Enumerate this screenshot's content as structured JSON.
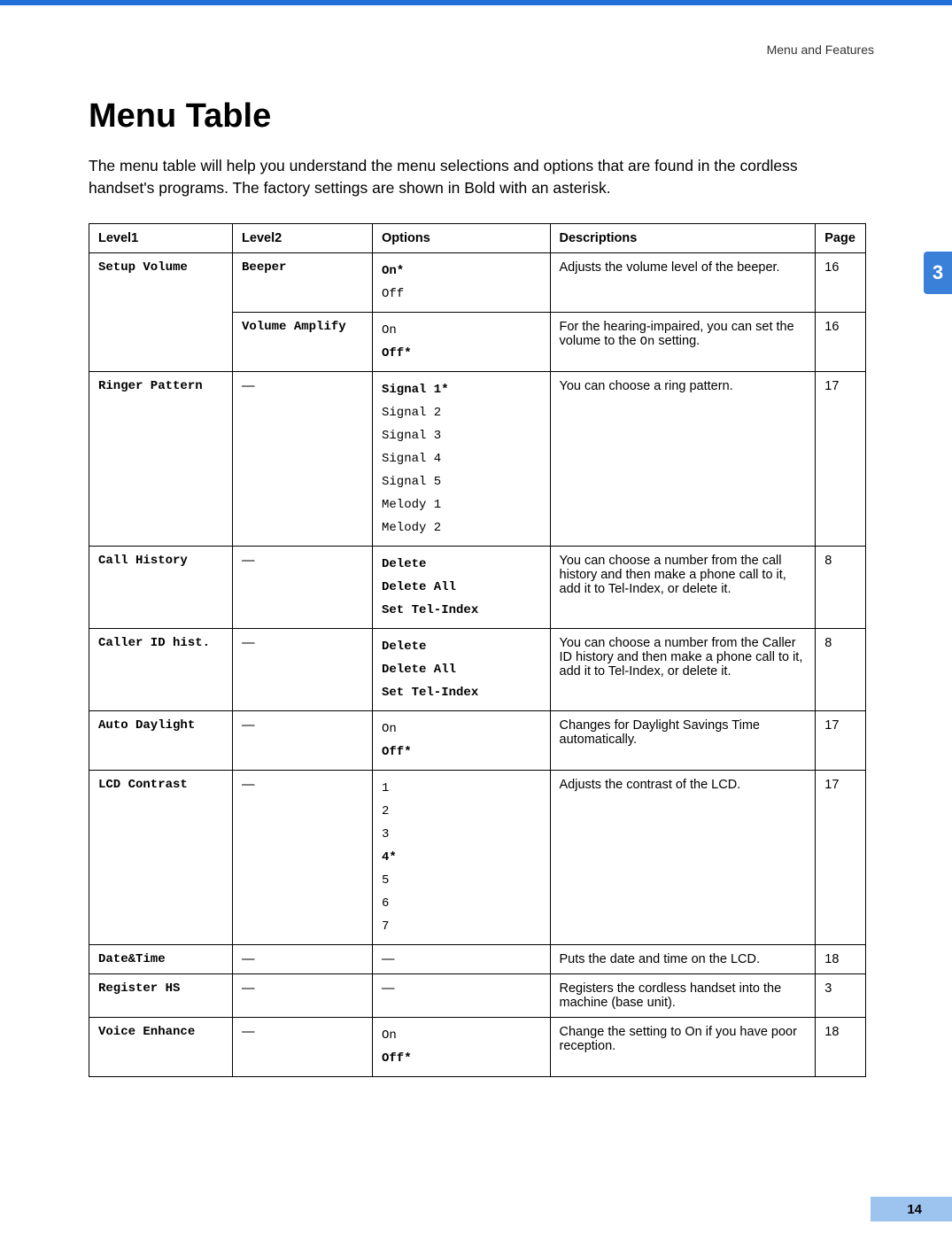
{
  "header": {
    "section_label": "Menu and Features"
  },
  "title": "Menu Table",
  "intro": "The menu table will help you understand the menu selections and options that are found in the cordless handset's programs. The factory settings are shown in Bold with an asterisk.",
  "side_tab": "3",
  "page_number": "14",
  "columns": {
    "level1": "Level1",
    "level2": "Level2",
    "options": "Options",
    "descriptions": "Descriptions",
    "page": "Page"
  },
  "rows": [
    {
      "level1": "Setup Volume",
      "level1_rowspan": 2,
      "level2": "Beeper",
      "options": [
        {
          "text": "On*",
          "bold": true
        },
        {
          "text": "Off",
          "bold": false
        }
      ],
      "desc_pre": "Adjusts the volume level of the beeper.",
      "page": "16"
    },
    {
      "level2": "Volume Amplify",
      "options": [
        {
          "text": "On",
          "bold": false
        },
        {
          "text": "Off*",
          "bold": true
        }
      ],
      "desc_pre": "For the hearing-impaired, you can set the volume to the ",
      "desc_mono": "On",
      "desc_post": " setting.",
      "page": "16"
    },
    {
      "level1": "Ringer Pattern",
      "level2": "—",
      "options": [
        {
          "text": "Signal 1*",
          "bold": true
        },
        {
          "text": "Signal 2",
          "bold": false
        },
        {
          "text": "Signal 3",
          "bold": false
        },
        {
          "text": "Signal 4",
          "bold": false
        },
        {
          "text": "Signal 5",
          "bold": false
        },
        {
          "text": "Melody 1",
          "bold": false
        },
        {
          "text": "Melody 2",
          "bold": false
        }
      ],
      "desc_pre": "You can choose a ring pattern.",
      "page": "17"
    },
    {
      "level1": "Call History",
      "level2": "—",
      "options": [
        {
          "text": "Delete",
          "bold": true
        },
        {
          "text": "Delete All",
          "bold": true
        },
        {
          "text": "Set Tel-Index",
          "bold": true
        }
      ],
      "desc_pre": "You can choose a number from the call history and then make a phone call to it, add it to Tel-Index, or delete it.",
      "page": "8"
    },
    {
      "level1": "Caller ID hist.",
      "level2": "—",
      "options": [
        {
          "text": "Delete",
          "bold": true
        },
        {
          "text": "Delete All",
          "bold": true
        },
        {
          "text": "Set Tel-Index",
          "bold": true
        }
      ],
      "desc_pre": "You can choose a number from the Caller ID history and then make a phone call to it, add it to Tel-Index, or delete it.",
      "page": "8"
    },
    {
      "level1": "Auto Daylight",
      "level2": "—",
      "options": [
        {
          "text": "On",
          "bold": false
        },
        {
          "text": "Off*",
          "bold": true
        }
      ],
      "desc_pre": "Changes for Daylight Savings Time automatically.",
      "page": "17"
    },
    {
      "level1": "LCD Contrast",
      "level2": "—",
      "options": [
        {
          "text": "1",
          "bold": false
        },
        {
          "text": "2",
          "bold": false
        },
        {
          "text": "3",
          "bold": false
        },
        {
          "text": "4*",
          "bold": true
        },
        {
          "text": "5",
          "bold": false
        },
        {
          "text": "6",
          "bold": false
        },
        {
          "text": "7",
          "bold": false
        }
      ],
      "desc_pre": "Adjusts the contrast of the LCD.",
      "page": "17"
    },
    {
      "level1": "Date&Time",
      "level2": "—",
      "options_dash": "—",
      "desc_pre": "Puts the date and time on the LCD.",
      "page": "18"
    },
    {
      "level1": "Register HS",
      "level2": "—",
      "options_dash": "—",
      "desc_pre": "Registers the cordless handset into the machine (base unit).",
      "page": "3"
    },
    {
      "level1": "Voice Enhance",
      "level2": "—",
      "options": [
        {
          "text": "On",
          "bold": false
        },
        {
          "text": "Off*",
          "bold": true
        }
      ],
      "desc_pre": "Change the setting to On if you have poor reception.",
      "page": "18"
    }
  ]
}
